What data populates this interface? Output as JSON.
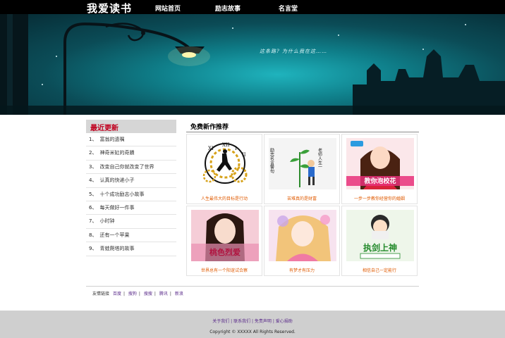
{
  "site": {
    "logo": "我爱读书"
  },
  "nav": [
    {
      "label": "网站首页"
    },
    {
      "label": "励志故事"
    },
    {
      "label": "名言堂"
    }
  ],
  "banner": {
    "caption": "这条路? 为什么我在这……"
  },
  "sidebar": {
    "title": "最近更新",
    "items": [
      {
        "num": "1、",
        "label": "富翁的遗嘱"
      },
      {
        "num": "2、",
        "label": "神奇米缸的奇蹟"
      },
      {
        "num": "3、",
        "label": "改变自己你就改变了世界"
      },
      {
        "num": "4、",
        "label": "认真的快递小子"
      },
      {
        "num": "5、",
        "label": "十个成功励志小故事"
      },
      {
        "num": "6、",
        "label": "每天做好一件事"
      },
      {
        "num": "7、",
        "label": "小时钟"
      },
      {
        "num": "8、",
        "label": "还有一个苹果"
      },
      {
        "num": "9、",
        "label": "青蛙爬塔的故事"
      }
    ]
  },
  "main": {
    "title": "免费新作推荐",
    "books": [
      {
        "caption": "人生最伟大的目标是行动",
        "cover_text": ""
      },
      {
        "caption": "苦难真的是财富",
        "cover_text": "励志名言警句"
      },
      {
        "caption": "一步一步教你经营你的婚姻",
        "cover_text": "教你泡校花"
      },
      {
        "caption": "世界总有一个阳谊试合察",
        "cover_text": "桃色烈爱"
      },
      {
        "caption": "有梦才有压力",
        "cover_text": ""
      },
      {
        "caption": "相信自己一定能行",
        "cover_text": "执剑上神"
      }
    ]
  },
  "friend_links": {
    "label": "友情链接",
    "items": [
      {
        "label": "百度"
      },
      {
        "label": "搜狗"
      },
      {
        "label": "搜搜"
      },
      {
        "label": "腾讯"
      },
      {
        "label": "新浪"
      }
    ],
    "separator": "|"
  },
  "footer": {
    "links": "关于我们 | 联系我们 | 免责声明 | 爱心捐助",
    "copyright": "Copyright © XXXXX All Rights Reserved."
  }
}
